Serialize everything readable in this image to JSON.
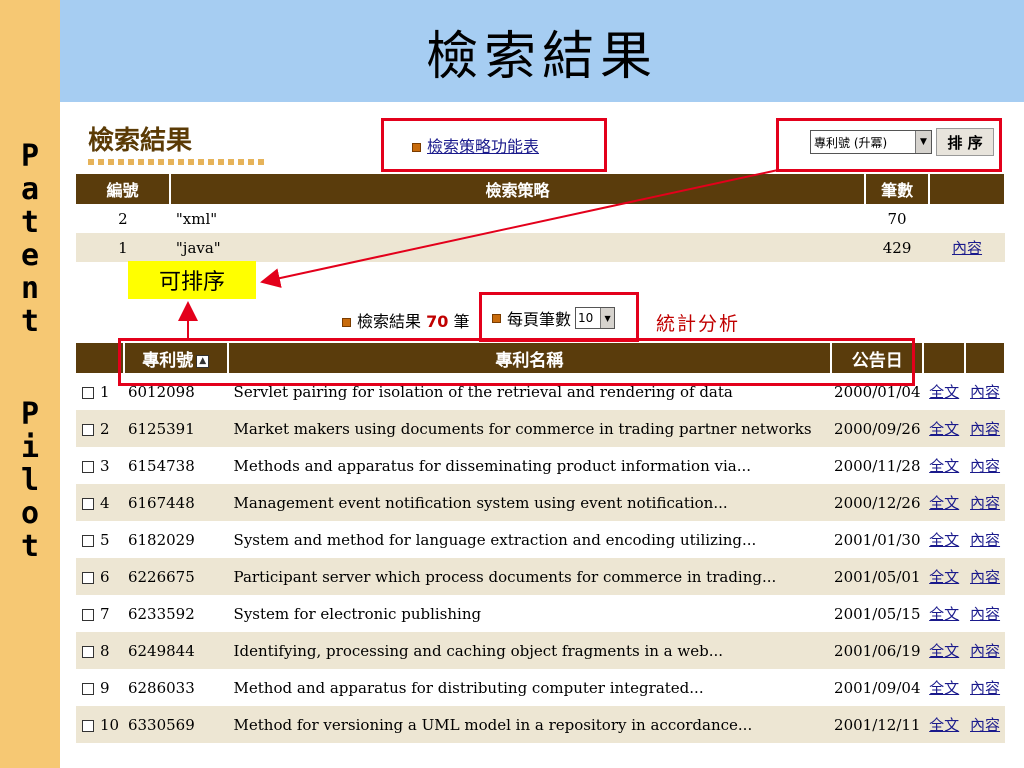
{
  "side_band": {
    "word1": [
      "P",
      "a",
      "t",
      "e",
      "n",
      "t"
    ],
    "word2": [
      "P",
      "i",
      "l",
      "o",
      "t"
    ]
  },
  "slide_title": "檢索結果",
  "panel": {
    "logo_text": "檢索結果",
    "strategy_link": "檢索策略功能表",
    "sort_select_value": "專利號 (升冪)",
    "sort_button": "排 序"
  },
  "strategy_table": {
    "headers": [
      "編號",
      "檢索策略",
      "筆數",
      ""
    ],
    "rows": [
      {
        "num": "2",
        "query": "\"xml\"",
        "count": "70",
        "link": ""
      },
      {
        "num": "1",
        "query": "\"java\"",
        "count": "429",
        "link": "內容"
      }
    ]
  },
  "callout": "可排序",
  "result_info": {
    "prefix": "檢索結果",
    "count": "70",
    "suffix": "筆",
    "per_page_label": "每頁筆數",
    "per_page_value": "10",
    "stats_link": "統計分析"
  },
  "results_table": {
    "headers": [
      "",
      "專利號",
      "專利名稱",
      "公告日",
      "",
      ""
    ],
    "rows": [
      {
        "idx": "1",
        "patent": "6012098",
        "title": "Servlet pairing for isolation of the retrieval and rendering of data",
        "date": "2000/01/04",
        "full": "全文",
        "detail": "內容"
      },
      {
        "idx": "2",
        "patent": "6125391",
        "title": "Market makers using documents for commerce in trading partner networks",
        "date": "2000/09/26",
        "full": "全文",
        "detail": "內容"
      },
      {
        "idx": "3",
        "patent": "6154738",
        "title": "Methods and apparatus for disseminating product information via...",
        "date": "2000/11/28",
        "full": "全文",
        "detail": "內容"
      },
      {
        "idx": "4",
        "patent": "6167448",
        "title": "Management event notification system using event notification...",
        "date": "2000/12/26",
        "full": "全文",
        "detail": "內容"
      },
      {
        "idx": "5",
        "patent": "6182029",
        "title": "System and method for language extraction and encoding utilizing...",
        "date": "2001/01/30",
        "full": "全文",
        "detail": "內容"
      },
      {
        "idx": "6",
        "patent": "6226675",
        "title": "Participant server which process documents for commerce in trading...",
        "date": "2001/05/01",
        "full": "全文",
        "detail": "內容"
      },
      {
        "idx": "7",
        "patent": "6233592",
        "title": "System for electronic publishing",
        "date": "2001/05/15",
        "full": "全文",
        "detail": "內容"
      },
      {
        "idx": "8",
        "patent": "6249844",
        "title": "Identifying, processing and caching object fragments in a web...",
        "date": "2001/06/19",
        "full": "全文",
        "detail": "內容"
      },
      {
        "idx": "9",
        "patent": "6286033",
        "title": "Method and apparatus for distributing computer integrated...",
        "date": "2001/09/04",
        "full": "全文",
        "detail": "內容"
      },
      {
        "idx": "10",
        "patent": "6330569",
        "title": "Method for versioning a UML model in a repository in accordance...",
        "date": "2001/12/11",
        "full": "全文",
        "detail": "內容"
      }
    ]
  },
  "colors": {
    "side_band": "#f6c873",
    "title_band": "#a6cdf2",
    "table_header": "#5a3c0c",
    "alt_row": "#ede6d3",
    "highlight_box": "#e3001b",
    "callout": "#ffff00"
  }
}
